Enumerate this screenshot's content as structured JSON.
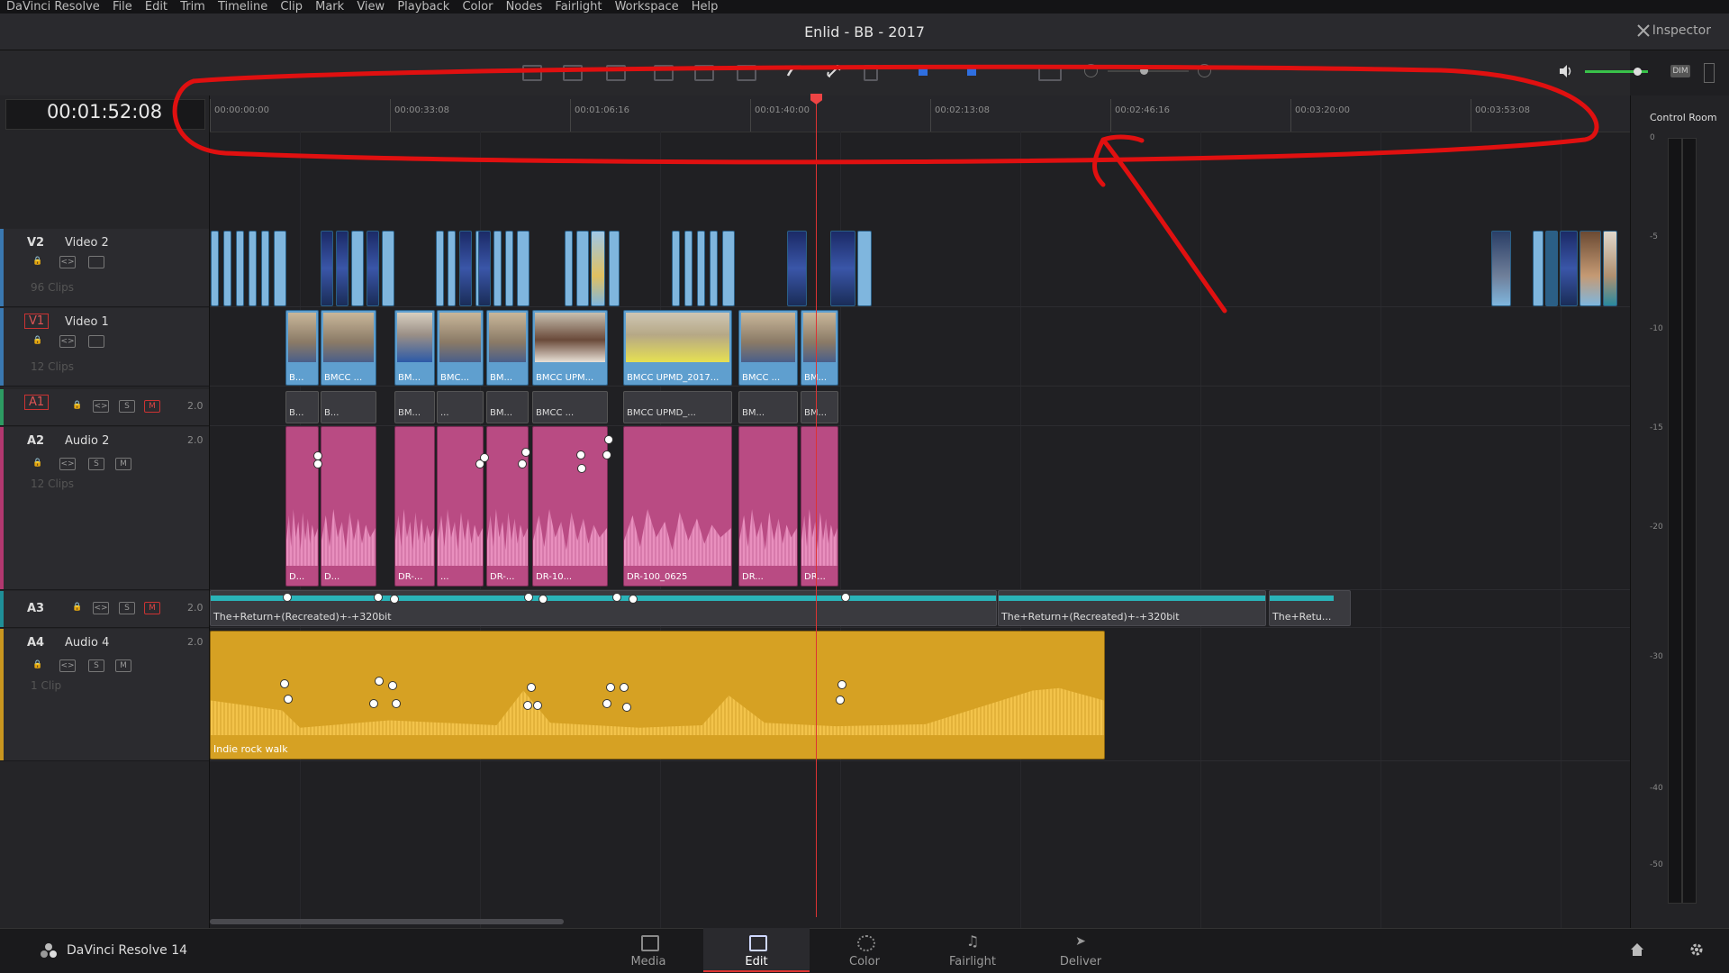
{
  "menu": [
    "DaVinci Resolve",
    "File",
    "Edit",
    "Trim",
    "Timeline",
    "Clip",
    "Mark",
    "View",
    "Playback",
    "Color",
    "Nodes",
    "Fairlight",
    "Workspace",
    "Help"
  ],
  "title": "Enlid - BB - 2017",
  "inspector": "Inspector",
  "timecode": "00:01:52:08",
  "ruler_labels": [
    "00:00:00:00",
    "00:00:33:08",
    "00:01:06:16",
    "00:01:40:00",
    "00:02:13:08",
    "00:02:46:16",
    "00:03:20:00",
    "00:03:53:08"
  ],
  "tracks": {
    "v2": {
      "id": "V2",
      "name": "Video 2",
      "clips": "96 Clips"
    },
    "v1": {
      "id": "V1",
      "name": "Video 1",
      "clips": "12 Clips"
    },
    "a1": {
      "id": "A1",
      "ch": "2.0"
    },
    "a2": {
      "id": "A2",
      "name": "Audio 2",
      "ch": "2.0",
      "clips": "12 Clips"
    },
    "a3": {
      "id": "A3",
      "ch": "2.0"
    },
    "a4": {
      "id": "A4",
      "name": "Audio 4",
      "ch": "2.0",
      "clips": "1 Clip"
    }
  },
  "controls": {
    "solo": "S",
    "mute": "M"
  },
  "v1_clips": [
    "B...",
    "BMCC ...",
    "BM...",
    "BMC...",
    "BM...",
    "BMCC UPM...",
    "BMCC UPMD_2017...",
    "BMCC ...",
    "BM..."
  ],
  "a1_clips": [
    "B...",
    "B...",
    "BM...",
    "...",
    "BM...",
    "BMCC ...",
    "BMCC UPMD_...",
    "BM...",
    "BM..."
  ],
  "a2_clips": [
    "D...",
    "D...",
    "DR-...",
    "...",
    "DR-...",
    "DR-10...",
    "DR-100_0625",
    "DR...",
    "DR..."
  ],
  "a3_clips": [
    "The+Return+(Recreated)+-+320bit",
    "The+Return+(Recreated)+-+320bit",
    "The+Retu..."
  ],
  "a4_clip": "Indie rock walk",
  "meter": {
    "title": "Control Room",
    "labels": [
      "0",
      "-5",
      "-10",
      "-15",
      "-20",
      "-30",
      "-40",
      "-50"
    ],
    "dim": "DIM"
  },
  "brand": "DaVinci Resolve 14",
  "pages": [
    "Media",
    "Edit",
    "Color",
    "Fairlight",
    "Deliver"
  ],
  "active_page": "Edit",
  "colors": {
    "annotation": "#e01010",
    "playhead": "#dd3333",
    "video": "#5f9fcf",
    "audio2": "#b94b83",
    "audio4": "#d6a123",
    "audio3": "#2ab3b8"
  }
}
